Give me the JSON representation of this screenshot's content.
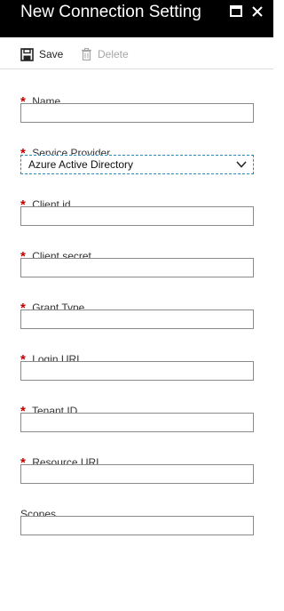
{
  "window": {
    "title": "New Connection Setting",
    "maximize_icon": "maximize-icon",
    "close_icon": "close-icon"
  },
  "toolbar": {
    "save_label": "Save",
    "save_icon": "save-disk-icon",
    "delete_label": "Delete",
    "delete_icon": "trash-icon",
    "delete_enabled": false
  },
  "form": {
    "required_marker": "*",
    "required_color": "#c00000",
    "fields": {
      "name": {
        "label": "Name",
        "required": true,
        "value": ""
      },
      "service_provider": {
        "label": "Service Provider",
        "required": true,
        "selected": "Azure Active Directory"
      },
      "client_id": {
        "label": "Client id",
        "required": true,
        "value": ""
      },
      "client_secret": {
        "label": "Client secret",
        "required": true,
        "value": ""
      },
      "grant_type": {
        "label": "Grant Type",
        "required": true,
        "value": ""
      },
      "login_url": {
        "label": "Login URL",
        "required": true,
        "value": ""
      },
      "tenant_id": {
        "label": "Tenant ID",
        "required": true,
        "value": ""
      },
      "resource_url": {
        "label": "Resource URL",
        "required": true,
        "value": ""
      },
      "scopes": {
        "label": "Scopes",
        "required": false,
        "value": ""
      }
    }
  },
  "colors": {
    "titlebar_bg": "#000000",
    "titlebar_text": "#ffffff",
    "focus_border": "#2d87b8",
    "disabled_text": "#a6a6a6"
  }
}
